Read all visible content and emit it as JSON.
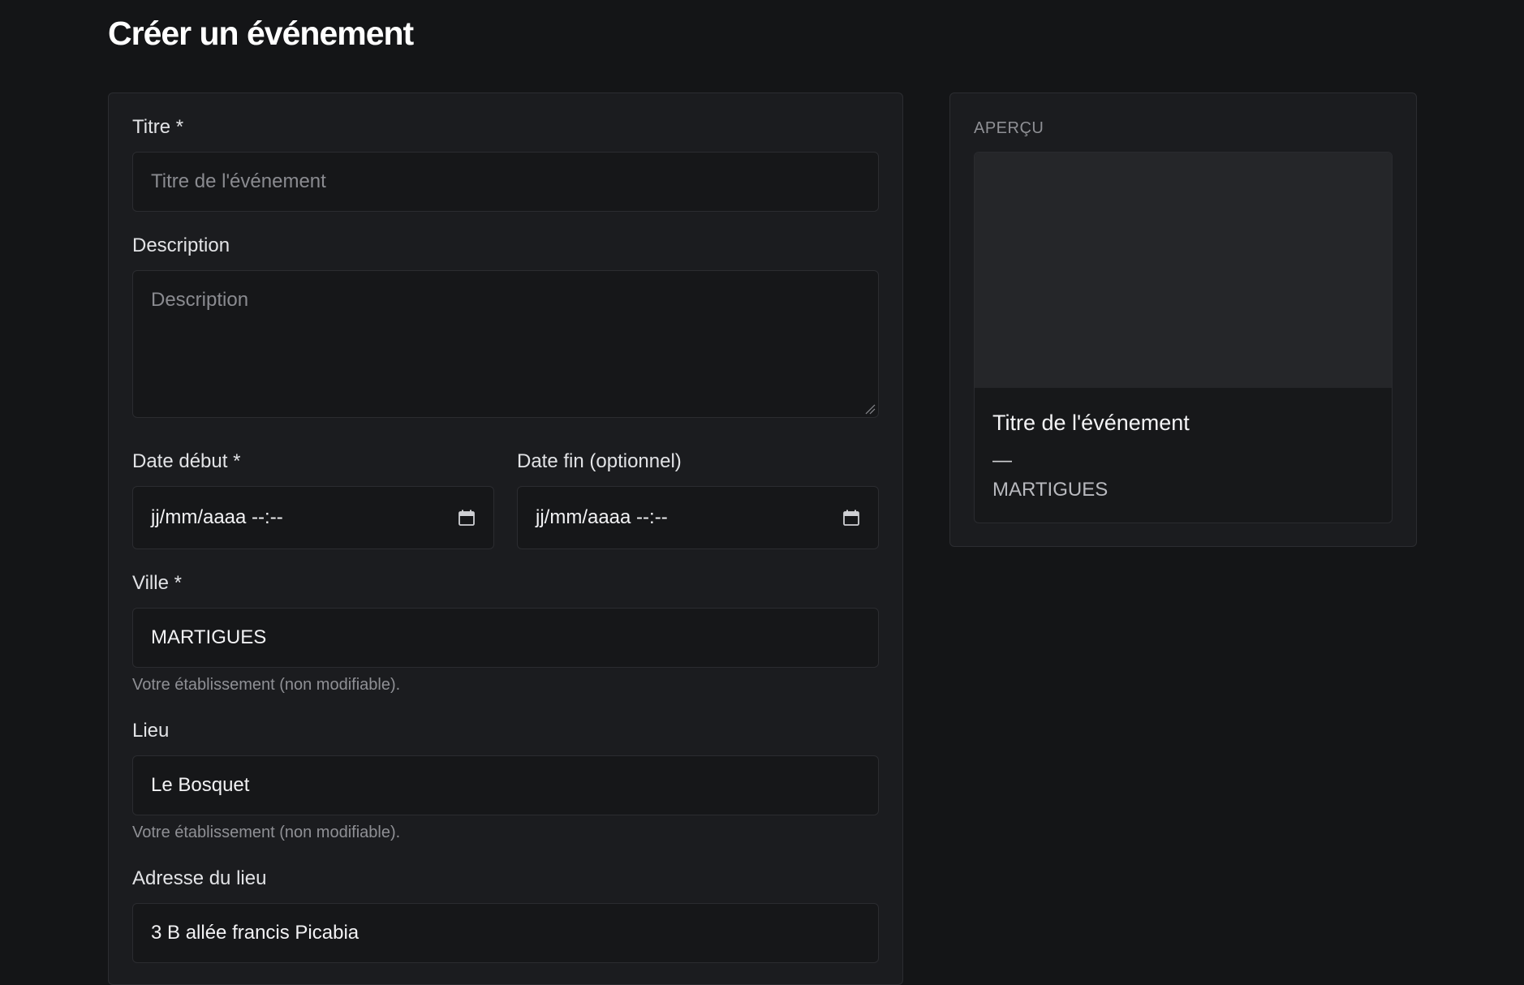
{
  "page": {
    "title": "Créer un événement"
  },
  "form": {
    "titre": {
      "label": "Titre *",
      "placeholder": "Titre de l'événement",
      "value": ""
    },
    "description": {
      "label": "Description",
      "placeholder": "Description",
      "value": ""
    },
    "date_debut": {
      "label": "Date début *",
      "value": "jj/mm/aaaa --:--"
    },
    "date_fin": {
      "label": "Date fin (optionnel)",
      "value": "jj/mm/aaaa --:--"
    },
    "ville": {
      "label": "Ville *",
      "value": "MARTIGUES",
      "help": "Votre établissement (non modifiable)."
    },
    "lieu": {
      "label": "Lieu",
      "value": "Le Bosquet",
      "help": "Votre établissement (non modifiable)."
    },
    "adresse": {
      "label": "Adresse du lieu",
      "value": "3 B allée francis Picabia"
    }
  },
  "preview": {
    "heading": "APERÇU",
    "title": "Titre de l'événement",
    "date": "—",
    "city": "MARTIGUES"
  },
  "icons": {
    "date_picker": "calendar-icon"
  },
  "colors": {
    "background": "#141517",
    "card": "#1b1c1f",
    "input": "#161719",
    "image_placeholder": "#252629"
  }
}
